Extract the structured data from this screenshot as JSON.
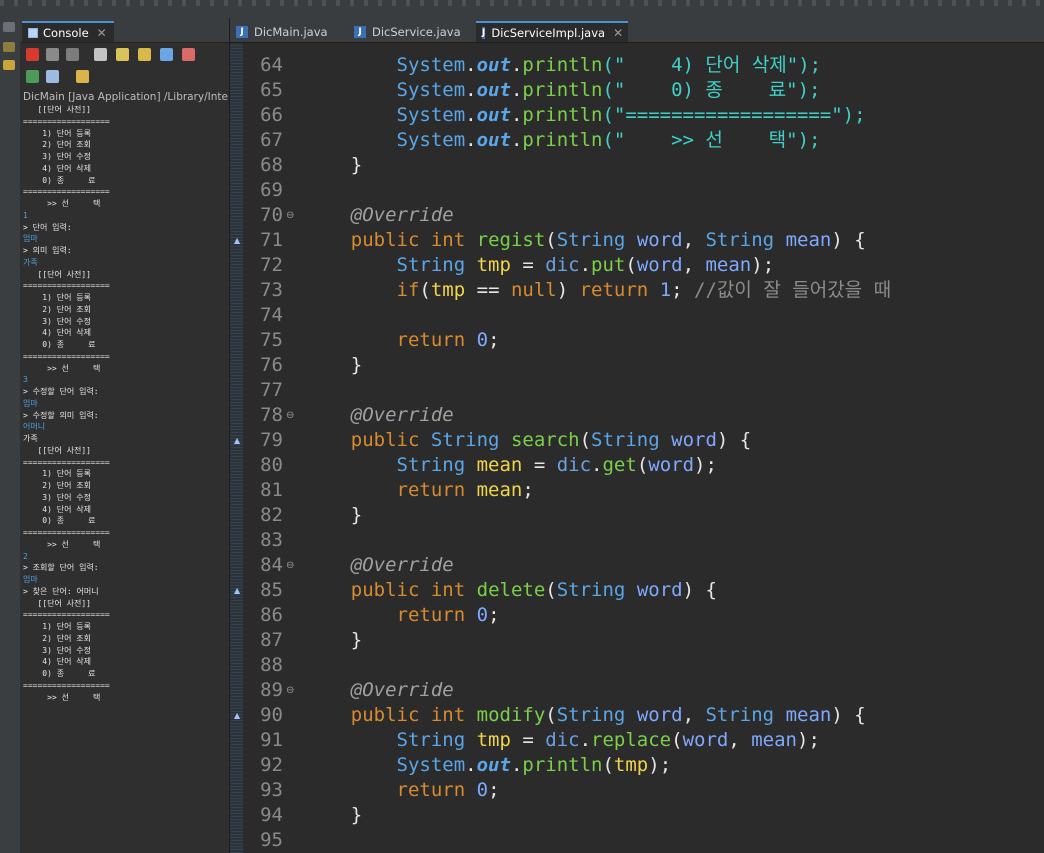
{
  "console": {
    "tab_label": "Console",
    "header": "DicMain [Java Application] /Library/Inte",
    "lines": [
      {
        "t": "   [[단어 사전]]",
        "k": "out"
      },
      {
        "t": "==================",
        "k": "out"
      },
      {
        "t": "    1) 단어 등록",
        "k": "out"
      },
      {
        "t": "    2) 단어 조회",
        "k": "out"
      },
      {
        "t": "    3) 단어 수정",
        "k": "out"
      },
      {
        "t": "    4) 단어 삭제",
        "k": "out"
      },
      {
        "t": "    0) 종     료",
        "k": "out"
      },
      {
        "t": "==================",
        "k": "out"
      },
      {
        "t": "     >> 선     택",
        "k": "out"
      },
      {
        "t": "1",
        "k": "in"
      },
      {
        "t": "> 단어 입력:",
        "k": "out"
      },
      {
        "t": "엄마",
        "k": "in"
      },
      {
        "t": "> 의미 입력:",
        "k": "out"
      },
      {
        "t": "가족",
        "k": "in"
      },
      {
        "t": "   [[단어 사전]]",
        "k": "out"
      },
      {
        "t": "==================",
        "k": "out"
      },
      {
        "t": "    1) 단어 등록",
        "k": "out"
      },
      {
        "t": "    2) 단어 조회",
        "k": "out"
      },
      {
        "t": "    3) 단어 수정",
        "k": "out"
      },
      {
        "t": "    4) 단어 삭제",
        "k": "out"
      },
      {
        "t": "    0) 종     료",
        "k": "out"
      },
      {
        "t": "==================",
        "k": "out"
      },
      {
        "t": "     >> 선     택",
        "k": "out"
      },
      {
        "t": "3",
        "k": "in"
      },
      {
        "t": "> 수정할 단어 입력:",
        "k": "out"
      },
      {
        "t": "엄마",
        "k": "in"
      },
      {
        "t": "> 수정할 의미 입력:",
        "k": "out"
      },
      {
        "t": "어머니",
        "k": "in"
      },
      {
        "t": "가족",
        "k": "out"
      },
      {
        "t": "   [[단어 사전]]",
        "k": "out"
      },
      {
        "t": "==================",
        "k": "out"
      },
      {
        "t": "    1) 단어 등록",
        "k": "out"
      },
      {
        "t": "    2) 단어 조회",
        "k": "out"
      },
      {
        "t": "    3) 단어 수정",
        "k": "out"
      },
      {
        "t": "    4) 단어 삭제",
        "k": "out"
      },
      {
        "t": "    0) 종     료",
        "k": "out"
      },
      {
        "t": "==================",
        "k": "out"
      },
      {
        "t": "     >> 선     택",
        "k": "out"
      },
      {
        "t": "2",
        "k": "in"
      },
      {
        "t": "> 조회할 단어 입력:",
        "k": "out"
      },
      {
        "t": "엄마",
        "k": "in"
      },
      {
        "t": "> 찾은 단어: 어머니",
        "k": "out"
      },
      {
        "t": "   [[단어 사전]]",
        "k": "out"
      },
      {
        "t": "==================",
        "k": "out"
      },
      {
        "t": "    1) 단어 등록",
        "k": "out"
      },
      {
        "t": "    2) 단어 조회",
        "k": "out"
      },
      {
        "t": "    3) 단어 수정",
        "k": "out"
      },
      {
        "t": "    4) 단어 삭제",
        "k": "out"
      },
      {
        "t": "    0) 종     료",
        "k": "out"
      },
      {
        "t": "==================",
        "k": "out"
      },
      {
        "t": "     >> 선     택",
        "k": "out"
      }
    ]
  },
  "editor": {
    "tabs": [
      {
        "label": "DicMain.java",
        "active": false
      },
      {
        "label": "DicService.java",
        "active": false
      },
      {
        "label": "DicServiceImpl.java",
        "active": true
      }
    ],
    "lines": [
      {
        "n": "64",
        "fold": false,
        "ovr": false,
        "tokens": [
          [
            "        ",
            "pl"
          ],
          [
            "System",
            "cls"
          ],
          [
            ".",
            "pl"
          ],
          [
            "out",
            "fld"
          ],
          [
            ".",
            "pl"
          ],
          [
            "println",
            "mt"
          ],
          [
            "(\"    4) 단어 삭제\");",
            "st"
          ]
        ]
      },
      {
        "n": "65",
        "fold": false,
        "ovr": false,
        "tokens": [
          [
            "        ",
            "pl"
          ],
          [
            "System",
            "cls"
          ],
          [
            ".",
            "pl"
          ],
          [
            "out",
            "fld"
          ],
          [
            ".",
            "pl"
          ],
          [
            "println",
            "mt"
          ],
          [
            "(\"    0) 종    료\");",
            "st"
          ]
        ]
      },
      {
        "n": "66",
        "fold": false,
        "ovr": false,
        "tokens": [
          [
            "        ",
            "pl"
          ],
          [
            "System",
            "cls"
          ],
          [
            ".",
            "pl"
          ],
          [
            "out",
            "fld"
          ],
          [
            ".",
            "pl"
          ],
          [
            "println",
            "mt"
          ],
          [
            "(\"==================\");",
            "st"
          ]
        ]
      },
      {
        "n": "67",
        "fold": false,
        "ovr": false,
        "tokens": [
          [
            "        ",
            "pl"
          ],
          [
            "System",
            "cls"
          ],
          [
            ".",
            "pl"
          ],
          [
            "out",
            "fld"
          ],
          [
            ".",
            "pl"
          ],
          [
            "println",
            "mt"
          ],
          [
            "(\"    >> 선    택\");",
            "st"
          ]
        ]
      },
      {
        "n": "68",
        "fold": false,
        "ovr": false,
        "tokens": [
          [
            "    }",
            "pl"
          ]
        ]
      },
      {
        "n": "69",
        "fold": false,
        "ovr": false,
        "tokens": []
      },
      {
        "n": "70",
        "fold": true,
        "ovr": false,
        "tokens": [
          [
            "    ",
            "pl"
          ],
          [
            "@Override",
            "an"
          ]
        ]
      },
      {
        "n": "71",
        "fold": false,
        "ovr": true,
        "tokens": [
          [
            "    ",
            "pl"
          ],
          [
            "public",
            "kw"
          ],
          [
            " ",
            "pl"
          ],
          [
            "int",
            "kw"
          ],
          [
            " ",
            "pl"
          ],
          [
            "regist",
            "mt"
          ],
          [
            "(",
            "pl"
          ],
          [
            "String",
            "ty"
          ],
          [
            " ",
            "pl"
          ],
          [
            "word",
            "pr"
          ],
          [
            ", ",
            "pl"
          ],
          [
            "String",
            "ty"
          ],
          [
            " ",
            "pl"
          ],
          [
            "mean",
            "pr"
          ],
          [
            ") {",
            "pl"
          ]
        ]
      },
      {
        "n": "72",
        "fold": false,
        "ovr": false,
        "tokens": [
          [
            "        ",
            "pl"
          ],
          [
            "String",
            "ty"
          ],
          [
            " ",
            "pl"
          ],
          [
            "tmp",
            "lv"
          ],
          [
            " = ",
            "pl"
          ],
          [
            "dic",
            "fl"
          ],
          [
            ".",
            "pl"
          ],
          [
            "put",
            "mt"
          ],
          [
            "(",
            "pl"
          ],
          [
            "word",
            "pr"
          ],
          [
            ", ",
            "pl"
          ],
          [
            "mean",
            "pr"
          ],
          [
            ");",
            "pl"
          ]
        ]
      },
      {
        "n": "73",
        "fold": false,
        "ovr": false,
        "tokens": [
          [
            "        ",
            "pl"
          ],
          [
            "if",
            "kw"
          ],
          [
            "(",
            "pl"
          ],
          [
            "tmp",
            "lv"
          ],
          [
            " == ",
            "pl"
          ],
          [
            "null",
            "kw"
          ],
          [
            ") ",
            "pl"
          ],
          [
            "return",
            "kw"
          ],
          [
            " ",
            "pl"
          ],
          [
            "1",
            "nu"
          ],
          [
            "; ",
            "pl"
          ],
          [
            "//값이 잘 들어갔을 때",
            "cm"
          ]
        ]
      },
      {
        "n": "74",
        "fold": false,
        "ovr": false,
        "tokens": []
      },
      {
        "n": "75",
        "fold": false,
        "ovr": false,
        "tokens": [
          [
            "        ",
            "pl"
          ],
          [
            "return",
            "kw"
          ],
          [
            " ",
            "pl"
          ],
          [
            "0",
            "nu"
          ],
          [
            ";",
            "pl"
          ]
        ]
      },
      {
        "n": "76",
        "fold": false,
        "ovr": false,
        "tokens": [
          [
            "    }",
            "pl"
          ]
        ]
      },
      {
        "n": "77",
        "fold": false,
        "ovr": false,
        "tokens": []
      },
      {
        "n": "78",
        "fold": true,
        "ovr": false,
        "tokens": [
          [
            "    ",
            "pl"
          ],
          [
            "@Override",
            "an"
          ]
        ]
      },
      {
        "n": "79",
        "fold": false,
        "ovr": true,
        "tokens": [
          [
            "    ",
            "pl"
          ],
          [
            "public",
            "kw"
          ],
          [
            " ",
            "pl"
          ],
          [
            "String",
            "ty"
          ],
          [
            " ",
            "pl"
          ],
          [
            "search",
            "mt"
          ],
          [
            "(",
            "pl"
          ],
          [
            "String",
            "ty"
          ],
          [
            " ",
            "pl"
          ],
          [
            "word",
            "pr"
          ],
          [
            ") {",
            "pl"
          ]
        ]
      },
      {
        "n": "80",
        "fold": false,
        "ovr": false,
        "tokens": [
          [
            "        ",
            "pl"
          ],
          [
            "String",
            "ty"
          ],
          [
            " ",
            "pl"
          ],
          [
            "mean",
            "lv"
          ],
          [
            " = ",
            "pl"
          ],
          [
            "dic",
            "fl"
          ],
          [
            ".",
            "pl"
          ],
          [
            "get",
            "mt"
          ],
          [
            "(",
            "pl"
          ],
          [
            "word",
            "pr"
          ],
          [
            ");",
            "pl"
          ]
        ]
      },
      {
        "n": "81",
        "fold": false,
        "ovr": false,
        "tokens": [
          [
            "        ",
            "pl"
          ],
          [
            "return",
            "kw"
          ],
          [
            " ",
            "pl"
          ],
          [
            "mean",
            "lv"
          ],
          [
            ";",
            "pl"
          ]
        ]
      },
      {
        "n": "82",
        "fold": false,
        "ovr": false,
        "tokens": [
          [
            "    }",
            "pl"
          ]
        ]
      },
      {
        "n": "83",
        "fold": false,
        "ovr": false,
        "tokens": []
      },
      {
        "n": "84",
        "fold": true,
        "ovr": false,
        "tokens": [
          [
            "    ",
            "pl"
          ],
          [
            "@Override",
            "an"
          ]
        ]
      },
      {
        "n": "85",
        "fold": false,
        "ovr": true,
        "tokens": [
          [
            "    ",
            "pl"
          ],
          [
            "public",
            "kw"
          ],
          [
            " ",
            "pl"
          ],
          [
            "int",
            "kw"
          ],
          [
            " ",
            "pl"
          ],
          [
            "delete",
            "mt"
          ],
          [
            "(",
            "pl"
          ],
          [
            "String",
            "ty"
          ],
          [
            " ",
            "pl"
          ],
          [
            "word",
            "pr"
          ],
          [
            ") {",
            "pl"
          ]
        ]
      },
      {
        "n": "86",
        "fold": false,
        "ovr": false,
        "tokens": [
          [
            "        ",
            "pl"
          ],
          [
            "return",
            "kw"
          ],
          [
            " ",
            "pl"
          ],
          [
            "0",
            "nu"
          ],
          [
            ";",
            "pl"
          ]
        ]
      },
      {
        "n": "87",
        "fold": false,
        "ovr": false,
        "tokens": [
          [
            "    }",
            "pl"
          ]
        ]
      },
      {
        "n": "88",
        "fold": false,
        "ovr": false,
        "tokens": []
      },
      {
        "n": "89",
        "fold": true,
        "ovr": false,
        "tokens": [
          [
            "    ",
            "pl"
          ],
          [
            "@Override",
            "an"
          ]
        ]
      },
      {
        "n": "90",
        "fold": false,
        "ovr": true,
        "tokens": [
          [
            "    ",
            "pl"
          ],
          [
            "public",
            "kw"
          ],
          [
            " ",
            "pl"
          ],
          [
            "int",
            "kw"
          ],
          [
            " ",
            "pl"
          ],
          [
            "modify",
            "mt"
          ],
          [
            "(",
            "pl"
          ],
          [
            "String",
            "ty"
          ],
          [
            " ",
            "pl"
          ],
          [
            "word",
            "pr"
          ],
          [
            ", ",
            "pl"
          ],
          [
            "String",
            "ty"
          ],
          [
            " ",
            "pl"
          ],
          [
            "mean",
            "pr"
          ],
          [
            ") {",
            "pl"
          ]
        ]
      },
      {
        "n": "91",
        "fold": false,
        "ovr": false,
        "tokens": [
          [
            "        ",
            "pl"
          ],
          [
            "String",
            "ty"
          ],
          [
            " ",
            "pl"
          ],
          [
            "tmp",
            "lv"
          ],
          [
            " = ",
            "pl"
          ],
          [
            "dic",
            "fl"
          ],
          [
            ".",
            "pl"
          ],
          [
            "replace",
            "mt"
          ],
          [
            "(",
            "pl"
          ],
          [
            "word",
            "pr"
          ],
          [
            ", ",
            "pl"
          ],
          [
            "mean",
            "pr"
          ],
          [
            ");",
            "pl"
          ]
        ]
      },
      {
        "n": "92",
        "fold": false,
        "ovr": false,
        "tokens": [
          [
            "        ",
            "pl"
          ],
          [
            "System",
            "cls"
          ],
          [
            ".",
            "pl"
          ],
          [
            "out",
            "fld"
          ],
          [
            ".",
            "pl"
          ],
          [
            "println",
            "mt"
          ],
          [
            "(",
            "pl"
          ],
          [
            "tmp",
            "lv"
          ],
          [
            ");",
            "pl"
          ]
        ]
      },
      {
        "n": "93",
        "fold": false,
        "ovr": false,
        "tokens": [
          [
            "        ",
            "pl"
          ],
          [
            "return",
            "kw"
          ],
          [
            " ",
            "pl"
          ],
          [
            "0",
            "nu"
          ],
          [
            ";",
            "pl"
          ]
        ]
      },
      {
        "n": "94",
        "fold": false,
        "ovr": false,
        "tokens": [
          [
            "    }",
            "pl"
          ]
        ]
      },
      {
        "n": "95",
        "fold": false,
        "ovr": false,
        "tokens": []
      }
    ]
  }
}
